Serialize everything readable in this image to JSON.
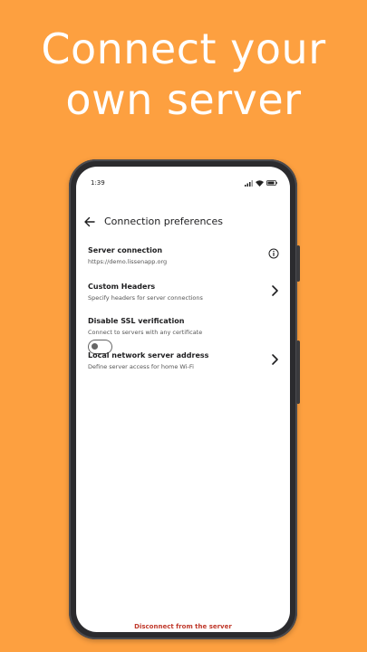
{
  "headline": {
    "line1": "Connect your",
    "line2": "own server"
  },
  "status_bar": {
    "time": "1:39",
    "icons": [
      "signal-icon",
      "wifi-icon",
      "battery-icon"
    ]
  },
  "appbar": {
    "back_icon": "arrow-left-icon",
    "title": "Connection preferences"
  },
  "settings": [
    {
      "title": "Server connection",
      "subtitle": "https://demo.lissenapp.org",
      "trailing": "info-icon"
    },
    {
      "title": "Custom Headers",
      "subtitle": "Specify headers for server connections",
      "trailing": "chevron-right-icon"
    },
    {
      "title": "Disable SSL verification",
      "subtitle": "Connect to servers with any certificate",
      "trailing": "toggle"
    },
    {
      "title": "Local network server address",
      "subtitle": "Define server access for home Wi-Fi",
      "trailing": "chevron-right-icon"
    }
  ],
  "ssl_toggle": {
    "on": false
  },
  "footer": {
    "disconnect_label": "Disconnect from the server"
  },
  "colors": {
    "background": "#FDA040",
    "danger": "#C0392B",
    "text": "#1D1D1F"
  }
}
